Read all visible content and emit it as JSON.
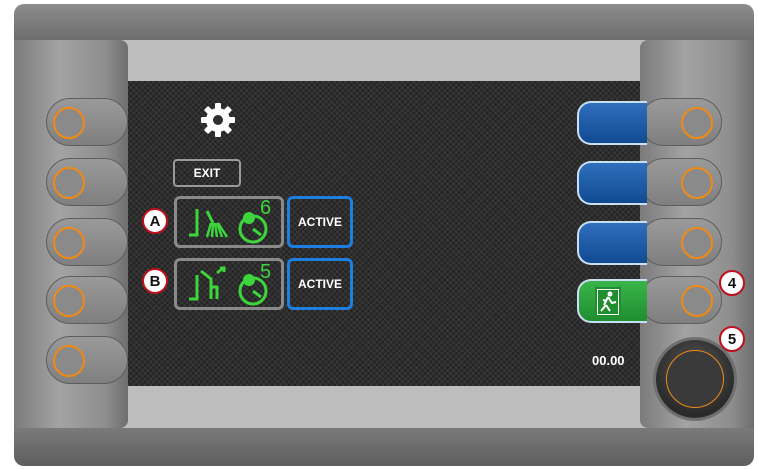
{
  "screen": {
    "exit_label": "EXIT",
    "time": "00.00",
    "icon": "gear-icon"
  },
  "functions": [
    {
      "marker": "A",
      "icon": "brush-with-timer-icon",
      "timer_digit": "6",
      "status": "ACTIVE"
    },
    {
      "marker": "B",
      "icon": "rear-unit-with-timer-icon",
      "timer_digit": "5",
      "status": "ACTIVE"
    }
  ],
  "right_callouts": [
    "4",
    "5"
  ],
  "soft_keys": [
    {
      "name": "soft-key-1",
      "icon": ""
    },
    {
      "name": "soft-key-2",
      "icon": ""
    },
    {
      "name": "soft-key-3",
      "icon": ""
    },
    {
      "name": "soft-key-exit",
      "icon": "emergency-exit-icon"
    }
  ],
  "colors": {
    "accent_green": "#3cd63c",
    "active_blue": "#1e7fe0",
    "ring_orange": "#f08a14",
    "marker_red": "#c0101c"
  }
}
